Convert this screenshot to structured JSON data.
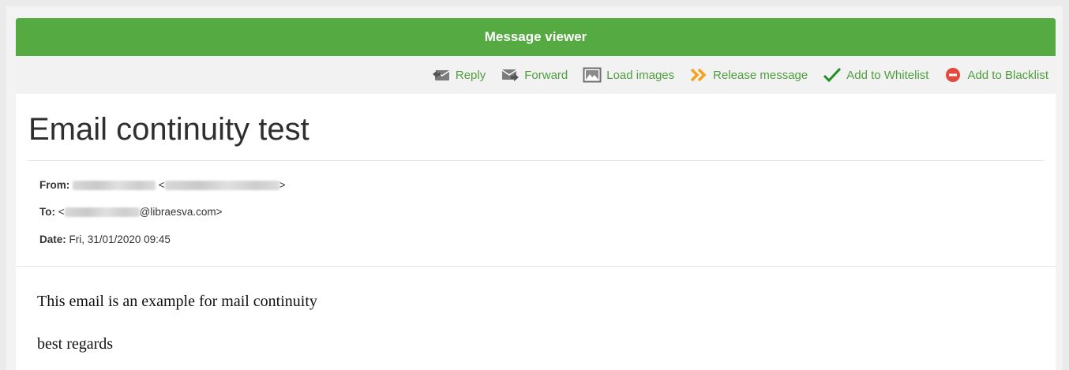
{
  "window": {
    "title": "Message viewer"
  },
  "toolbar": {
    "reply": "Reply",
    "forward": "Forward",
    "load_images": "Load images",
    "release": "Release message",
    "whitelist": "Add to Whitelist",
    "blacklist": "Add to Blacklist"
  },
  "icons": {
    "reply": "reply-envelope-icon",
    "forward": "forward-envelope-icon",
    "load_images": "image-icon",
    "release": "double-chevron-right-icon",
    "whitelist": "checkmark-icon",
    "blacklist": "minus-circle-icon"
  },
  "colors": {
    "accent": "#55ab42",
    "link": "#4f9e3e",
    "release": "#f4a21d",
    "check": "#1f8f1f",
    "blacklist": "#e0493c"
  },
  "message": {
    "subject": "Email continuity test",
    "from_label": "From:",
    "from_lt": "<",
    "from_gt": ">",
    "to_label": "To:",
    "to_prefix": "<",
    "to_suffix": "@libraesva.com>",
    "date_label": "Date:",
    "date_value": "Fri, 31/01/2020 09:45",
    "body_line1": "This email is an example for mail continuity",
    "body_line2": "best regards"
  }
}
